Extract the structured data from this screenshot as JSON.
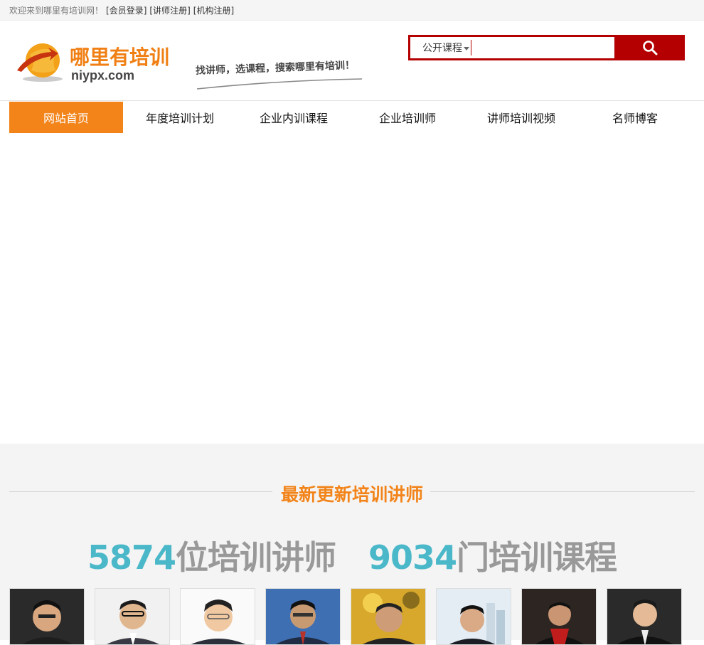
{
  "topbar": {
    "welcome": "欢迎来到哪里有培训网！",
    "links": [
      "[会员登录]",
      "[讲师注册]",
      "[机构注册]"
    ]
  },
  "logo": {
    "name": "哪里有培训",
    "domain": "niypx.com"
  },
  "slogan": "找讲师，选课程，搜索哪里有培训！",
  "search": {
    "category": "公开课程",
    "value": "",
    "button_icon": "search-icon"
  },
  "nav": {
    "items": [
      "网站首页",
      "年度培训计划",
      "企业内训课程",
      "企业培训师",
      "讲师培训视频",
      "名师博客"
    ],
    "active_index": 0
  },
  "section": {
    "title": "最新更新培训讲师",
    "stats": [
      {
        "number": "5874",
        "text": "位培训讲师"
      },
      {
        "number": "9034",
        "text": "门培训课程"
      }
    ]
  },
  "colors": {
    "accent": "#f2841a",
    "search_red": "#b40000",
    "stat_number": "#4ab8c9",
    "stat_text": "#999999"
  }
}
